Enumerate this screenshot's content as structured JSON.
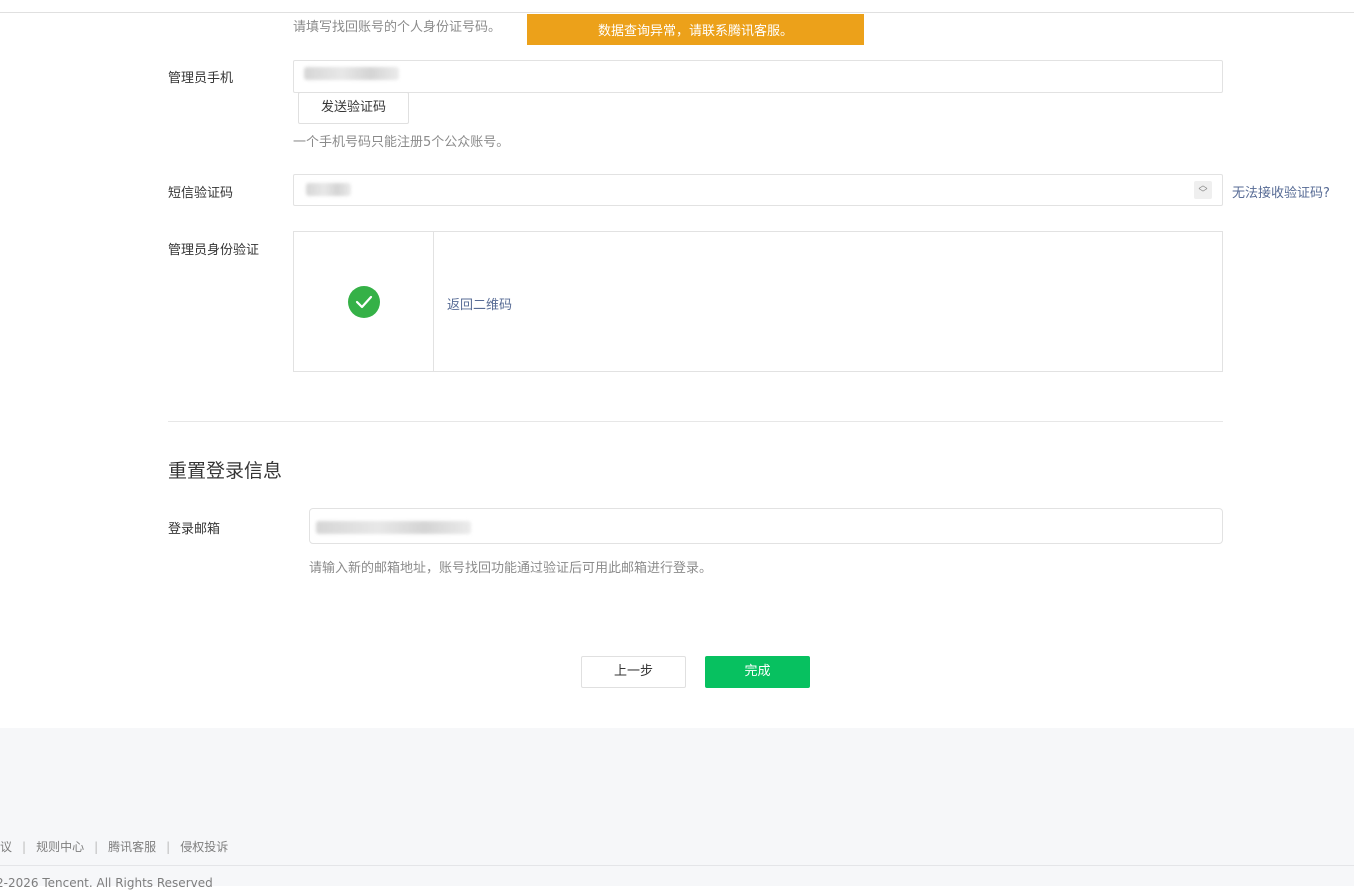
{
  "id_hint": "请填写找回账号的个人身份证号码。",
  "toast": "数据查询异常，请联系腾讯客服。",
  "phone": {
    "label": "管理员手机",
    "send_code_button": "发送验证码",
    "hint": "一个手机号码只能注册5个公众账号。"
  },
  "sms": {
    "label": "短信验证码",
    "cannot_receive_link": "无法接收验证码?"
  },
  "identity": {
    "label": "管理员身份验证",
    "return_qr_link": "返回二维码"
  },
  "reset": {
    "title": "重置登录信息",
    "email_label": "登录邮箱",
    "email_hint": "请输入新的邮箱地址，账号找回功能通过验证后可用此邮箱进行登录。"
  },
  "actions": {
    "prev_button": "上一步",
    "done_button": "完成"
  },
  "footer": {
    "links": [
      "协议",
      "规则中心",
      "腾讯客服",
      "侵权投诉"
    ],
    "copyright": "2-2026 Tencent. All Rights Reserved"
  },
  "colors": {
    "primary": "#07c160",
    "toast": "#eca11a",
    "link": "#576b95"
  }
}
